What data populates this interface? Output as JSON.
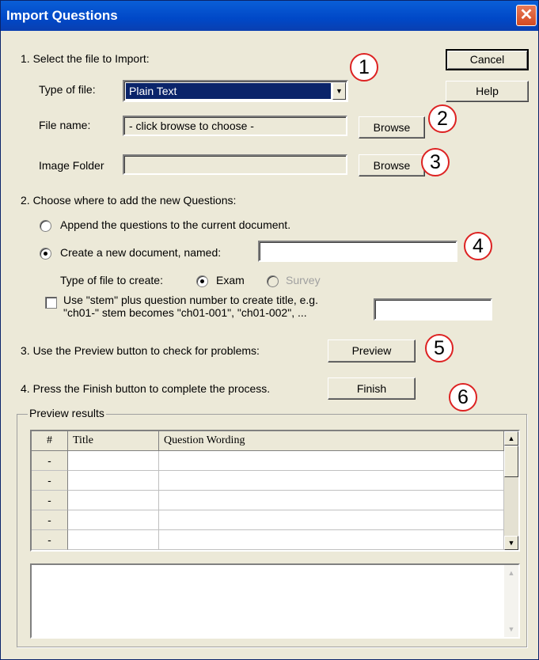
{
  "window": {
    "title": "Import Questions",
    "close_symbol": "✕"
  },
  "buttons": {
    "cancel": "Cancel",
    "help": "Help",
    "browse_file": "Browse",
    "browse_image": "Browse",
    "preview": "Preview",
    "finish": "Finish"
  },
  "step1": {
    "heading": "1. Select the file to Import:",
    "type_label": "Type of file:",
    "type_value": "Plain Text",
    "filename_label": "File name:",
    "filename_value": "- click browse to choose -",
    "image_folder_label": "Image Folder",
    "image_folder_value": ""
  },
  "step2": {
    "heading": "2. Choose where to add the new Questions:",
    "append_label": "Append the questions to the current document.",
    "append_selected": false,
    "create_label": "Create a new document, named:",
    "create_selected": true,
    "new_doc_name": "",
    "type_create_label": "Type of file to create:",
    "exam_label": "Exam",
    "survey_label": "Survey",
    "exam_selected": true,
    "stem_checked": false,
    "stem_line1": "Use \"stem\" plus question number to create title,  e.g.",
    "stem_line2": "\"ch01-\" stem becomes \"ch01-001\",  \"ch01-002\",  ...",
    "stem_value": ""
  },
  "step3": {
    "text": "3. Use the Preview button to check for problems:"
  },
  "step4": {
    "text": "4. Press the Finish button to complete the process."
  },
  "callouts": [
    "1",
    "2",
    "3",
    "4",
    "5",
    "6"
  ],
  "preview": {
    "group_label": "Preview results",
    "columns": [
      "#",
      "Title",
      "Question Wording"
    ],
    "rows": [
      "-",
      "-",
      "-",
      "-",
      "-"
    ],
    "details_text": ""
  },
  "icons": {
    "dropdown": "chevron-down-icon",
    "scroll_up": "arrow-up-icon",
    "scroll_down": "arrow-down-icon"
  }
}
